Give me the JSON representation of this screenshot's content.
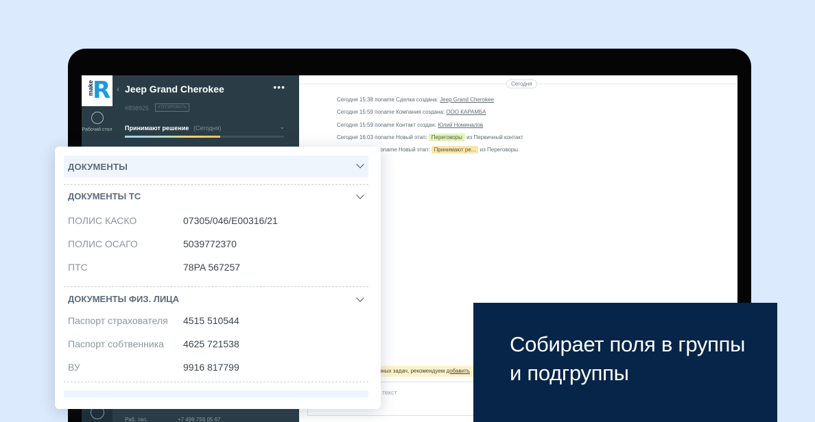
{
  "app": {
    "logo_small": "make",
    "logo_letter": "R",
    "rail_desk_label": "Рабочий стол"
  },
  "lead": {
    "back": "‹",
    "title": "Jeep Grand Cherokee",
    "more": "•••",
    "id": "#898925",
    "tag_button": "#ТЕГИРОВАТЬ",
    "stage": "Принимают решение",
    "stage_date": "(Сегодня)",
    "stage_progress_percent": 60,
    "manager_label": "Раб. тел.",
    "manager_phone": "+7 499 756 05 67"
  },
  "feed": {
    "today_label": "Сегодня",
    "events": [
      {
        "text": "Сегодня 15:38 поname Сделка создана:",
        "link": "Jeep Grand Cherokee"
      },
      {
        "text": "Сегодня 15:59 поname Компания создана:",
        "link": "ООО КАРАМБА"
      },
      {
        "text": "Сегодня 15:59 поname Контакт создан:",
        "link": "Юлий Номиналов"
      },
      {
        "text": "Сегодня 16:03 поname Новый этап:",
        "pill": "Переговоры",
        "pill_color": "#e1f5b6",
        "suffix": "из Первичный контакт"
      },
      {
        "text": "поname Новый этап:",
        "pill": "Принимают ре...",
        "pill_color": "#fbe6a9",
        "suffix": "из Переговоры"
      }
    ],
    "hint_text": "нных задач, рекомендуем",
    "hint_link": "добавить",
    "input_placeholder": "текст"
  },
  "documents": {
    "header": "ДОКУМЕНТЫ",
    "groups": [
      {
        "title": "ДОКУМЕНТЫ ТС",
        "fields": [
          {
            "label": "ПОЛИС КАСКО",
            "value": "07305/046/E00316/21"
          },
          {
            "label": "ПОЛИС ОСАГО",
            "value": "5039772370"
          },
          {
            "label": "ПТС",
            "value": "78PA 567257"
          }
        ]
      },
      {
        "title": "ДОКУМЕНТЫ ФИЗ. ЛИЦА",
        "fields": [
          {
            "label": "Паспорт страхователя",
            "value": "4515 510544"
          },
          {
            "label": "Паспорт собтвенника",
            "value": "4625 721538"
          },
          {
            "label": "ВУ",
            "value": "9916 817799"
          }
        ]
      }
    ]
  },
  "promo": {
    "text": "Собирает поля в группы и подгруппы"
  },
  "colors": {
    "background": "#dbeafc",
    "sidebar": "#2a3d47",
    "accent_blue": "#1e9ad8",
    "promo_bg": "#062548"
  }
}
